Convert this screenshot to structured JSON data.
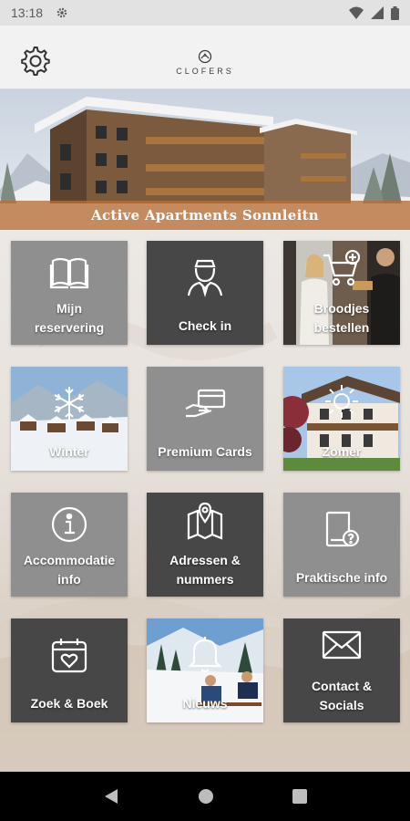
{
  "status_bar": {
    "time": "13:18"
  },
  "header": {
    "logo_text": "CLOFERS"
  },
  "hero": {
    "title": "Active Apartments Sonnleitn"
  },
  "tiles": [
    {
      "label_line1": "Mijn",
      "label_line2": "reservering",
      "icon": "book-icon"
    },
    {
      "label": "Check in",
      "icon": "receptionist-icon"
    },
    {
      "label_line1": "Broodjes",
      "label_line2": "bestellen",
      "icon": "cart-plus-icon"
    },
    {
      "label": "Winter",
      "icon": "snowflake-icon"
    },
    {
      "label": "Premium Cards",
      "icon": "card-hand-icon"
    },
    {
      "label": "Zomer",
      "icon": "sun-icon"
    },
    {
      "label_line1": "Accommodatie",
      "label_line2": "info",
      "icon": "info-icon"
    },
    {
      "label_line1": "Adressen &",
      "label_line2": "nummers",
      "icon": "map-pin-icon"
    },
    {
      "label": "Praktische info",
      "icon": "booklet-question-icon"
    },
    {
      "label": "Zoek & Boek",
      "icon": "calendar-heart-icon"
    },
    {
      "label": "Nieuws",
      "icon": "bell-icon"
    },
    {
      "label_line1": "Contact &",
      "label_line2": "Socials",
      "icon": "envelope-icon"
    }
  ],
  "colors": {
    "tile_light": "#8f8f8f",
    "tile_dark": "#474747",
    "banner": "#b96e37",
    "header_bg": "#f2f2f2"
  }
}
